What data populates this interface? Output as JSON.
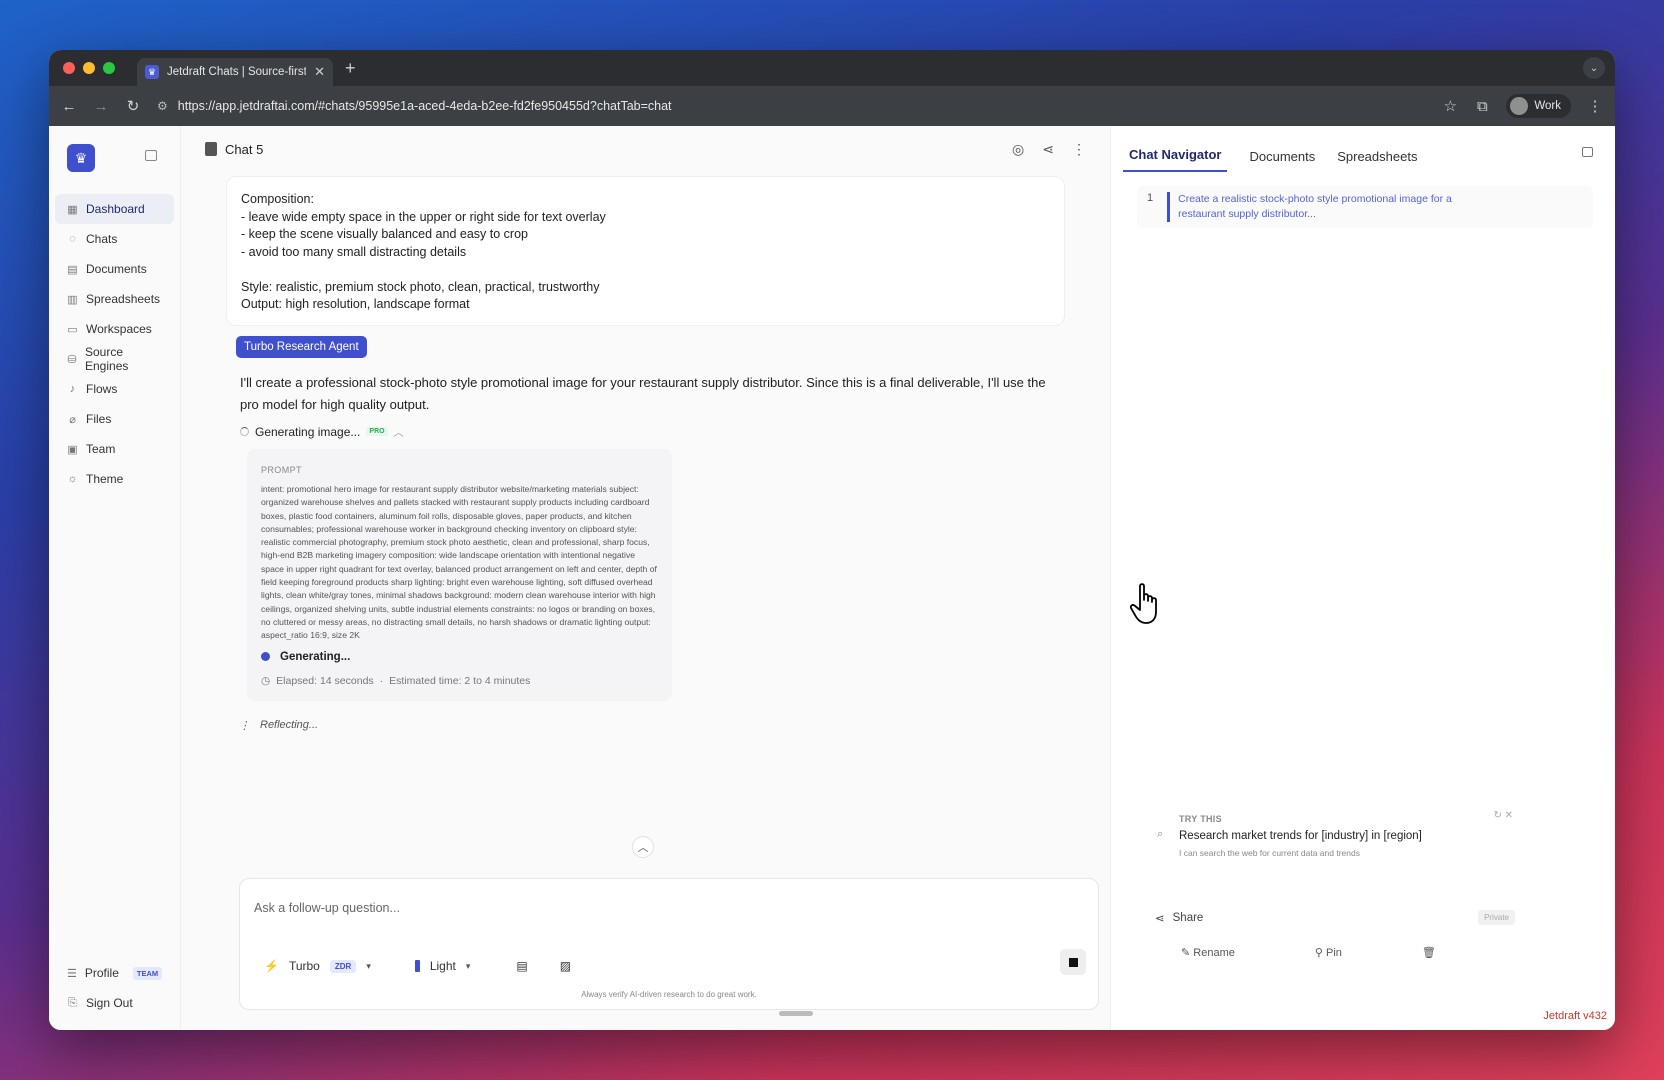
{
  "browser": {
    "tab_title": "Jetdraft Chats | Source-first",
    "url": "https://app.jetdraftai.com/#chats/95995e1a-aced-4eda-b2ee-fd2fe950455d?chatTab=chat",
    "profile_label": "Work"
  },
  "sidebar": {
    "items": [
      {
        "label": "Dashboard",
        "icon": "grid-icon"
      },
      {
        "label": "Chats",
        "icon": "chat-icon"
      },
      {
        "label": "Documents",
        "icon": "document-icon"
      },
      {
        "label": "Spreadsheets",
        "icon": "spreadsheet-icon"
      },
      {
        "label": "Workspaces",
        "icon": "folder-icon"
      },
      {
        "label": "Source Engines",
        "icon": "database-icon"
      },
      {
        "label": "Flows",
        "icon": "flow-icon"
      },
      {
        "label": "Files",
        "icon": "paperclip-icon"
      },
      {
        "label": "Team",
        "icon": "team-icon"
      },
      {
        "label": "Theme",
        "icon": "sun-icon"
      }
    ],
    "profile_label": "Profile",
    "team_badge": "TEAM",
    "signout_label": "Sign Out"
  },
  "chat": {
    "title": "Chat 5",
    "user_message_lines": [
      "Composition:",
      "- leave wide empty space in the upper or right side for text overlay",
      "- keep the scene visually balanced and easy to crop",
      "- avoid too many small distracting details",
      "",
      "Style: realistic, premium stock photo, clean, practical, trustworthy",
      "Output: high resolution, landscape format"
    ],
    "agent_tag": "Turbo Research Agent",
    "agent_text": "I'll create a professional stock-photo style promotional image for your restaurant supply distributor. Since this is a final deliverable, I'll use the pro model for high quality output.",
    "generating_label": "Generating image...",
    "pro_badge": "PRO",
    "prompt_label": "PROMPT",
    "prompt_body": "intent: promotional hero image for restaurant supply distributor website/marketing materials subject: organized warehouse shelves and pallets stacked with restaurant supply products including cardboard boxes, plastic food containers, aluminum foil rolls, disposable gloves, paper products, and kitchen consumables; professional warehouse worker in background checking inventory on clipboard style: realistic commercial photography, premium stock photo aesthetic, clean and professional, sharp focus, high-end B2B marketing imagery composition: wide landscape orientation with intentional negative space in upper right quadrant for text overlay, balanced product arrangement on left and center, depth of field keeping foreground products sharp lighting: bright even warehouse lighting, soft diffused overhead lights, clean white/gray tones, minimal shadows background: modern clean warehouse interior with high ceilings, organized shelving units, subtle industrial elements constraints: no logos or branding on boxes, no cluttered or messy areas, no distracting small details, no harsh shadows or dramatic lighting output: aspect_ratio 16:9, size 2K",
    "status_generating": "Generating...",
    "elapsed": "Elapsed: 14 seconds",
    "estimated": "Estimated time: 2 to 4 minutes",
    "reflecting": "Reflecting..."
  },
  "composer": {
    "placeholder": "Ask a follow-up question...",
    "mode_label": "Turbo",
    "zdr_badge": "ZDR",
    "theme_label": "Light",
    "disclaimer": "Always verify AI-driven research to do great work."
  },
  "right_panel": {
    "tabs": [
      "Chat Navigator",
      "Documents",
      "Spreadsheets"
    ],
    "nav_entries": [
      {
        "number": "1",
        "text": "Create a realistic stock-photo style promotional image for a restaurant supply distributor..."
      }
    ],
    "try_label": "TRY THIS",
    "try_title": "Research market trends for [industry] in [region]",
    "try_sub": "I can search the web for current data and trends",
    "share_label": "Share",
    "private_badge": "Private",
    "rename_label": "Rename",
    "pin_label": "Pin",
    "version": "Jetdraft v432"
  },
  "colors": {
    "accent": "#3f4fce",
    "version_red": "#c0392b"
  }
}
